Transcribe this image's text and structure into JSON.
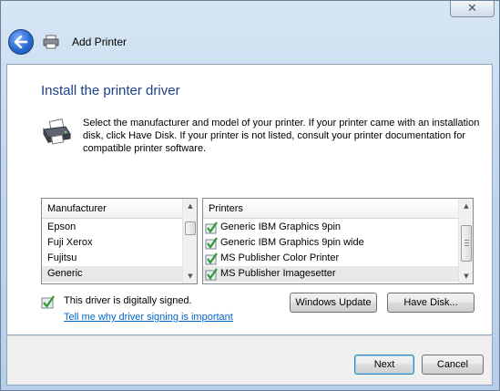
{
  "window": {
    "title": "Add Printer",
    "close_label": "✕"
  },
  "page": {
    "heading": "Install the printer driver",
    "instruction": "Select the manufacturer and model of your printer. If your printer came with an installation disk, click Have Disk. If your printer is not listed, consult your printer documentation for compatible printer software."
  },
  "manufacturer_list": {
    "header": "Manufacturer",
    "items": [
      "Epson",
      "Fuji Xerox",
      "Fujitsu",
      "Generic"
    ],
    "selected": "Generic"
  },
  "printer_list": {
    "header": "Printers",
    "items": [
      "Generic IBM Graphics 9pin",
      "Generic IBM Graphics 9pin wide",
      "MS Publisher Color Printer",
      "MS Publisher Imagesetter"
    ],
    "selected": "MS Publisher Imagesetter"
  },
  "signing": {
    "status": "This driver is digitally signed.",
    "link": "Tell me why driver signing is important"
  },
  "buttons": {
    "windows_update": "Windows Update",
    "have_disk": "Have Disk...",
    "next": "Next",
    "cancel": "Cancel"
  },
  "colors": {
    "heading": "#1e3f87",
    "link": "#0066cc",
    "frame": "#c3d8ee"
  }
}
